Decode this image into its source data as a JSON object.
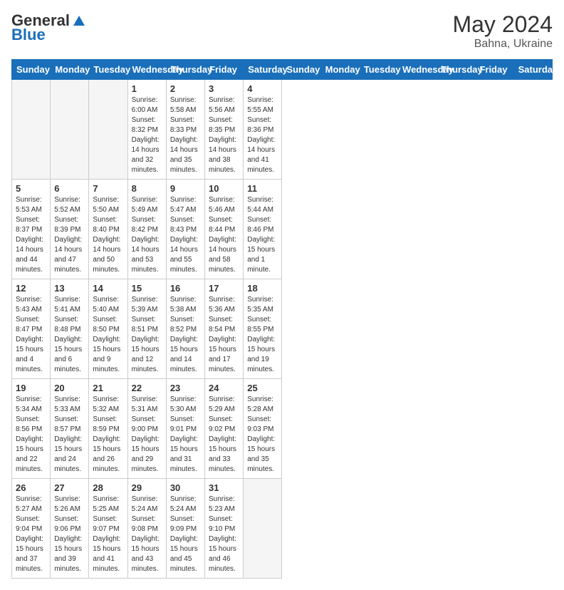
{
  "header": {
    "logo_general": "General",
    "logo_blue": "Blue",
    "month_year": "May 2024",
    "location": "Bahna, Ukraine"
  },
  "days_of_week": [
    "Sunday",
    "Monday",
    "Tuesday",
    "Wednesday",
    "Thursday",
    "Friday",
    "Saturday"
  ],
  "weeks": [
    [
      {
        "day": "",
        "empty": true
      },
      {
        "day": "",
        "empty": true
      },
      {
        "day": "",
        "empty": true
      },
      {
        "day": "1",
        "sunrise": "6:00 AM",
        "sunset": "8:32 PM",
        "daylight": "14 hours and 32 minutes."
      },
      {
        "day": "2",
        "sunrise": "5:58 AM",
        "sunset": "8:33 PM",
        "daylight": "14 hours and 35 minutes."
      },
      {
        "day": "3",
        "sunrise": "5:56 AM",
        "sunset": "8:35 PM",
        "daylight": "14 hours and 38 minutes."
      },
      {
        "day": "4",
        "sunrise": "5:55 AM",
        "sunset": "8:36 PM",
        "daylight": "14 hours and 41 minutes."
      }
    ],
    [
      {
        "day": "5",
        "sunrise": "5:53 AM",
        "sunset": "8:37 PM",
        "daylight": "14 hours and 44 minutes."
      },
      {
        "day": "6",
        "sunrise": "5:52 AM",
        "sunset": "8:39 PM",
        "daylight": "14 hours and 47 minutes."
      },
      {
        "day": "7",
        "sunrise": "5:50 AM",
        "sunset": "8:40 PM",
        "daylight": "14 hours and 50 minutes."
      },
      {
        "day": "8",
        "sunrise": "5:49 AM",
        "sunset": "8:42 PM",
        "daylight": "14 hours and 53 minutes."
      },
      {
        "day": "9",
        "sunrise": "5:47 AM",
        "sunset": "8:43 PM",
        "daylight": "14 hours and 55 minutes."
      },
      {
        "day": "10",
        "sunrise": "5:46 AM",
        "sunset": "8:44 PM",
        "daylight": "14 hours and 58 minutes."
      },
      {
        "day": "11",
        "sunrise": "5:44 AM",
        "sunset": "8:46 PM",
        "daylight": "15 hours and 1 minute."
      }
    ],
    [
      {
        "day": "12",
        "sunrise": "5:43 AM",
        "sunset": "8:47 PM",
        "daylight": "15 hours and 4 minutes."
      },
      {
        "day": "13",
        "sunrise": "5:41 AM",
        "sunset": "8:48 PM",
        "daylight": "15 hours and 6 minutes."
      },
      {
        "day": "14",
        "sunrise": "5:40 AM",
        "sunset": "8:50 PM",
        "daylight": "15 hours and 9 minutes."
      },
      {
        "day": "15",
        "sunrise": "5:39 AM",
        "sunset": "8:51 PM",
        "daylight": "15 hours and 12 minutes."
      },
      {
        "day": "16",
        "sunrise": "5:38 AM",
        "sunset": "8:52 PM",
        "daylight": "15 hours and 14 minutes."
      },
      {
        "day": "17",
        "sunrise": "5:36 AM",
        "sunset": "8:54 PM",
        "daylight": "15 hours and 17 minutes."
      },
      {
        "day": "18",
        "sunrise": "5:35 AM",
        "sunset": "8:55 PM",
        "daylight": "15 hours and 19 minutes."
      }
    ],
    [
      {
        "day": "19",
        "sunrise": "5:34 AM",
        "sunset": "8:56 PM",
        "daylight": "15 hours and 22 minutes."
      },
      {
        "day": "20",
        "sunrise": "5:33 AM",
        "sunset": "8:57 PM",
        "daylight": "15 hours and 24 minutes."
      },
      {
        "day": "21",
        "sunrise": "5:32 AM",
        "sunset": "8:59 PM",
        "daylight": "15 hours and 26 minutes."
      },
      {
        "day": "22",
        "sunrise": "5:31 AM",
        "sunset": "9:00 PM",
        "daylight": "15 hours and 29 minutes."
      },
      {
        "day": "23",
        "sunrise": "5:30 AM",
        "sunset": "9:01 PM",
        "daylight": "15 hours and 31 minutes."
      },
      {
        "day": "24",
        "sunrise": "5:29 AM",
        "sunset": "9:02 PM",
        "daylight": "15 hours and 33 minutes."
      },
      {
        "day": "25",
        "sunrise": "5:28 AM",
        "sunset": "9:03 PM",
        "daylight": "15 hours and 35 minutes."
      }
    ],
    [
      {
        "day": "26",
        "sunrise": "5:27 AM",
        "sunset": "9:04 PM",
        "daylight": "15 hours and 37 minutes."
      },
      {
        "day": "27",
        "sunrise": "5:26 AM",
        "sunset": "9:06 PM",
        "daylight": "15 hours and 39 minutes."
      },
      {
        "day": "28",
        "sunrise": "5:25 AM",
        "sunset": "9:07 PM",
        "daylight": "15 hours and 41 minutes."
      },
      {
        "day": "29",
        "sunrise": "5:24 AM",
        "sunset": "9:08 PM",
        "daylight": "15 hours and 43 minutes."
      },
      {
        "day": "30",
        "sunrise": "5:24 AM",
        "sunset": "9:09 PM",
        "daylight": "15 hours and 45 minutes."
      },
      {
        "day": "31",
        "sunrise": "5:23 AM",
        "sunset": "9:10 PM",
        "daylight": "15 hours and 46 minutes."
      },
      {
        "day": "",
        "empty": true
      }
    ]
  ]
}
